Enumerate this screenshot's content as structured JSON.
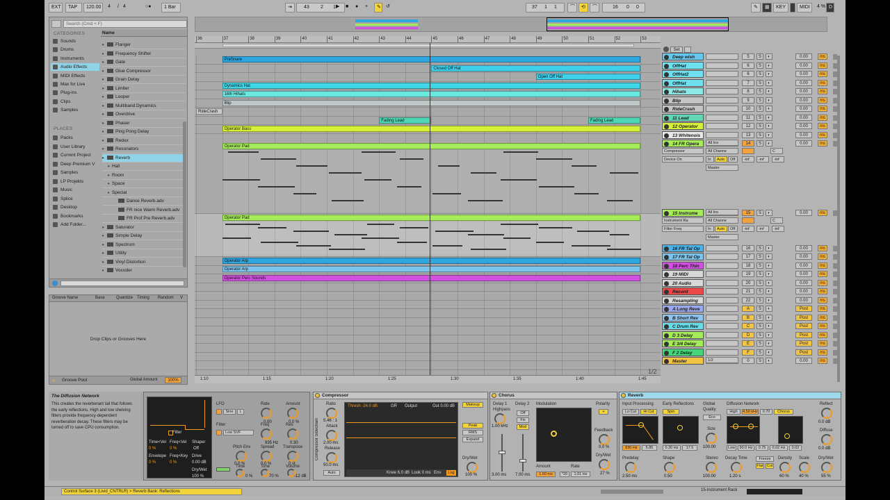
{
  "transport": {
    "ext": "EXT",
    "tap": "TAP",
    "tempo": "120.00",
    "sig_num": "4",
    "sig_den": "4",
    "metro": "○●",
    "quant": "1 Bar",
    "pos_bar": "43",
    "pos_beat": "2",
    "pos_sixteenth": "1",
    "loop_start_bar": "37",
    "loop_start_beat": "1",
    "loop_start_sixteenth": "1",
    "loop_len_bar": "16",
    "loop_len_beat": "0",
    "loop_len_sixteenth": "0",
    "key": "KEY",
    "midi": "MIDI",
    "cpu": "4 %",
    "d_indicator": "D"
  },
  "browser": {
    "search_placeholder": "Search (Cmd + F)",
    "categories_title": "CATEGORIES",
    "categories": [
      "Sounds",
      "Drums",
      "Instruments",
      "Audio Effects",
      "MIDI Effects",
      "Max for Live",
      "Plug-ins",
      "Clips",
      "Samples"
    ],
    "places_title": "PLACES",
    "places": [
      "Packs",
      "User Library",
      "Current Project",
      "Deep Premium V",
      "Samples",
      "LP Projekts",
      "Music",
      "Splice",
      "Desktop",
      "Bookmarks",
      "Add Folder..."
    ],
    "name_header": "Name",
    "files": [
      {
        "name": "Flanger",
        "indent": 0,
        "sel": false,
        "fold": true
      },
      {
        "name": "Frequency Shifter",
        "indent": 0,
        "sel": false,
        "fold": true
      },
      {
        "name": "Gate",
        "indent": 0,
        "sel": false,
        "fold": true
      },
      {
        "name": "Glue Compressor",
        "indent": 0,
        "sel": false,
        "fold": true
      },
      {
        "name": "Grain Delay",
        "indent": 0,
        "sel": false,
        "fold": true
      },
      {
        "name": "Limiter",
        "indent": 0,
        "sel": false,
        "fold": true
      },
      {
        "name": "Looper",
        "indent": 0,
        "sel": false,
        "fold": true
      },
      {
        "name": "Multiband Dynamics",
        "indent": 0,
        "sel": false,
        "fold": true
      },
      {
        "name": "Overdrive",
        "indent": 0,
        "sel": false,
        "fold": true
      },
      {
        "name": "Phaser",
        "indent": 0,
        "sel": false,
        "fold": true
      },
      {
        "name": "Ping Pong Delay",
        "indent": 0,
        "sel": false,
        "fold": true
      },
      {
        "name": "Redux",
        "indent": 0,
        "sel": false,
        "fold": true
      },
      {
        "name": "Resonators",
        "indent": 0,
        "sel": false,
        "fold": true
      },
      {
        "name": "Reverb",
        "indent": 0,
        "sel": true,
        "fold": true
      },
      {
        "name": "Hall",
        "indent": 1,
        "sel": false,
        "fold": false
      },
      {
        "name": "Room",
        "indent": 1,
        "sel": false,
        "fold": false
      },
      {
        "name": "Space",
        "indent": 1,
        "sel": false,
        "fold": false
      },
      {
        "name": "Special",
        "indent": 1,
        "sel": false,
        "fold": false
      },
      {
        "name": "Dance Reverb.adv",
        "indent": 2,
        "sel": false,
        "fold": false
      },
      {
        "name": "FR nice Warm Reverb.adv",
        "indent": 2,
        "sel": false,
        "fold": false
      },
      {
        "name": "FR Prof Pre Reverb.adv",
        "indent": 2,
        "sel": false,
        "fold": false
      },
      {
        "name": "Saturator",
        "indent": 0,
        "sel": false,
        "fold": true
      },
      {
        "name": "Simple Delay",
        "indent": 0,
        "sel": false,
        "fold": true
      },
      {
        "name": "Spectrum",
        "indent": 0,
        "sel": false,
        "fold": true
      },
      {
        "name": "Utility",
        "indent": 0,
        "sel": false,
        "fold": true
      },
      {
        "name": "Vinyl Distortion",
        "indent": 0,
        "sel": false,
        "fold": true
      },
      {
        "name": "Vocoder",
        "indent": 0,
        "sel": false,
        "fold": true
      }
    ]
  },
  "groove": {
    "cols": [
      "Groove Name",
      "Base",
      "Quantize",
      "Timing",
      "Random",
      "V"
    ],
    "drop_text": "Drop Clips or Grooves Here",
    "pool_label": "Groove Pool",
    "global_amount_label": "Global Amount",
    "global_amount": "100%"
  },
  "arrangement": {
    "ruler_marks": [
      "36",
      "37",
      "38",
      "39",
      "40",
      "41",
      "42",
      "43",
      "44",
      "45",
      "46",
      "47",
      "48",
      "49",
      "50",
      "51",
      "52",
      "53"
    ],
    "time_marks": [
      "1:10",
      "1:15",
      "1:20",
      "1:25",
      "1:30",
      "1:35",
      "1:40",
      "1:45"
    ],
    "zoom_label": "1/2",
    "clips": [
      {
        "lane": 0,
        "name": "PreSnare",
        "start": 37,
        "end": 53,
        "color": "#2fa6e0"
      },
      {
        "lane": 1,
        "name": "Closed Off Hat",
        "start": 45,
        "end": 53,
        "color": "#3fd0ec"
      },
      {
        "lane": 2,
        "name": "Open Off Hat",
        "start": 49,
        "end": 53,
        "color": "#3fd0ec"
      },
      {
        "lane": 3,
        "name": "Dynamics Hat",
        "start": 37,
        "end": 53,
        "color": "#3fd6e8"
      },
      {
        "lane": 4,
        "name": "16th Hihats",
        "start": 37,
        "end": 53,
        "color": "#69e8e0"
      },
      {
        "lane": 5,
        "name": "Blip",
        "start": 37,
        "end": 53,
        "color": "#bfc6c6"
      },
      {
        "lane": 6,
        "name": "RideCrash",
        "start": 36,
        "end": 37,
        "color": "#c9c9c9"
      },
      {
        "lane": 7,
        "name": "Fading Lead",
        "start": 43,
        "end": 45,
        "color": "#4fd6b4"
      },
      {
        "lane": 7,
        "name": "Fading Lead",
        "start": 51,
        "end": 53,
        "color": "#4fd6b4"
      },
      {
        "lane": 8,
        "name": "Operator Bass",
        "start": 37,
        "end": 53,
        "color": "#d6f03a"
      },
      {
        "lane": 9,
        "name": "Operator Pad",
        "start": 37,
        "end": 53,
        "color": "#a6ec5a"
      },
      {
        "lane": 10,
        "name": "Operator Pad",
        "start": 37,
        "end": 53,
        "color": "#a6ec5a"
      },
      {
        "lane": 11,
        "name": "Operator Arp",
        "start": 37,
        "end": 53,
        "color": "#2fa6e0"
      },
      {
        "lane": 12,
        "name": "Operator Arp",
        "start": 37,
        "end": 53,
        "color": "#7cc4ec"
      },
      {
        "lane": 13,
        "name": "Operator Perc Sounds",
        "start": 37,
        "end": 53,
        "color": "#d250e0"
      }
    ]
  },
  "tracks": [
    {
      "name": "Deep wish",
      "color": "#66c8ef",
      "num": "5"
    },
    {
      "name": "OffHat",
      "color": "#6ee0ef",
      "num": "6"
    },
    {
      "name": "OffHat2",
      "color": "#6ee0ef",
      "num": "6"
    },
    {
      "name": "OffHat",
      "color": "#6ee0ef",
      "num": "7"
    },
    {
      "name": "Hihats",
      "color": "#8ee8e6",
      "num": "8"
    },
    {
      "name": "Blip",
      "color": "#c4c4c4",
      "num": "9"
    },
    {
      "name": "RideCrash",
      "color": "#c4c4c4",
      "num": "10"
    },
    {
      "name": "11 Lead",
      "color": "#62d8b6",
      "num": "11"
    },
    {
      "name": "12 Operator",
      "color": "#d6f03a",
      "num": "12"
    },
    {
      "name": "13 Whitenois",
      "color": "#e8e8e8",
      "num": "13"
    },
    {
      "name": "14 FR Opera",
      "color": "#a6ec5a",
      "num": "14"
    },
    {
      "name": "15 Instrume",
      "color": "#a6ec5a",
      "num": "15"
    },
    {
      "name": "16 FR Tal Op",
      "color": "#4cb2e6",
      "num": "16"
    },
    {
      "name": "17 FR Tal Op",
      "color": "#7cc4ec",
      "num": "17"
    },
    {
      "name": "18 Perc Thin",
      "color": "#d250e0",
      "num": "18"
    },
    {
      "name": "19 MIDI",
      "color": "#d8d8d8",
      "num": "19"
    },
    {
      "name": "20 Audio",
      "color": "#d8d8d8",
      "num": "20"
    },
    {
      "name": "Record",
      "color": "#ea4848",
      "num": "21"
    },
    {
      "name": "Resampling",
      "color": "#d8d8d8",
      "num": "22"
    },
    {
      "name": "A Long Reve",
      "color": "#9aa8ee",
      "num": "A"
    },
    {
      "name": "B Short Rev",
      "color": "#8fc4ee",
      "num": "B"
    },
    {
      "name": "C Drum Rev",
      "color": "#6cdbe8",
      "num": "C"
    },
    {
      "name": "D 3 Delay",
      "color": "#a6ec5a",
      "num": "D"
    },
    {
      "name": "E 3/4 Delay",
      "color": "#a6ec5a",
      "num": "E"
    },
    {
      "name": "F 2 Delay",
      "color": "#42d87a",
      "num": "F"
    },
    {
      "name": "Master",
      "color": "#f2c444",
      "num": "0"
    }
  ],
  "track_common": {
    "s": "S",
    "vol": "0.00",
    "ms": "ms",
    "post": "Post",
    "inf": "-inf",
    "all_ins": "All Ins",
    "all_chan": "All Channe",
    "in": "In",
    "auto": "Auto",
    "off": "Off",
    "master": "Master",
    "compressor": "Compressor",
    "device_on": "Device On",
    "instrument_rack": "Instrument Ra",
    "filter_freq": "Filter Freq",
    "c": "C",
    "set": "Set",
    "master_io": "1/2"
  },
  "info": {
    "title": "The Diffusion Network",
    "body": "This creates the reverberant tail that follows the early reflections. High and low shelving filters provide frequency-dependent reverberation decay. These filters may be turned off to save CPU consumption."
  },
  "instrument": {
    "lfo": "LFO",
    "rate": "Rate",
    "amount": "Amount",
    "sine": "Sine",
    "l": "L",
    "rate_val": "0.00",
    "amount_val": "0.0 %",
    "filter": "Filter",
    "filter_type": "Low SVF",
    "freq": "Freq",
    "freq_val": "935 Hz",
    "res": "Res",
    "res_val": "0.30",
    "pitch_env": "Pitch Env",
    "pitch_val": "0.0 %",
    "spread": "Spread",
    "spread_val": "0.0 %",
    "transpose": "Transpose",
    "transpose_val": "0 st",
    "time": "Time",
    "time_val": "0 %",
    "tone": "Tone",
    "tone_val": "70 %",
    "volume": "Volume",
    "volume_val": "-12 dB",
    "time_vel": "Time<Vel",
    "freq_vel": "Freq<Vel",
    "shaper": "Shaper",
    "envelope": "Envelope",
    "freq_key": "Freq<Key",
    "drive": "Drive",
    "dry_wet": "Dry/Wet",
    "shaper_val": "Off",
    "drive_val": "0.00 dB",
    "dry_wet_val": "100 %",
    "filter_label": "Filter",
    "zero": "0 %"
  },
  "compressor": {
    "title": "Compressor",
    "sidechain": "Compressor Sidechain",
    "ratio": "Ratio",
    "ratio_val": "5.46 : 1",
    "attack": "Attack",
    "attack_val": "2.00 ms",
    "release": "Release",
    "release_val": "50.0 ms",
    "auto": "Auto",
    "thresh": "Thresh -24.0 dB",
    "gr": "GR",
    "output": "Output",
    "out": "Out 0.00 dB",
    "makeup": "Makeup",
    "peak": "Peak",
    "rms": "RMS",
    "expand": "Expand",
    "knee": "Knee 6.0 dB",
    "look": "Look 0 ms",
    "env": "Env",
    "log": "Log",
    "dry_wet": "Dry/Wet",
    "dry_wet_val": "100 %"
  },
  "chorus": {
    "title": "Chorus",
    "delay1": "Delay 1",
    "delay2": "Delay 2",
    "highpass": "Highpass",
    "hp_val": "1.00 kHz",
    "off": "Off",
    "fix": "Fix",
    "mod": "Mod",
    "d1_val": "3.00 ms",
    "d2_val": "7.00 ms",
    "modulation": "Modulation",
    "amount": "Amount",
    "amount_val": "1.60 ms",
    "rate": "Rate",
    "rate_val": "1.01 Hz",
    "x20": "*20",
    "polarity": "Polarity",
    "plus": "+",
    "feedback": "Feedback",
    "fb_val": "0.0 %",
    "dry_wet": "Dry/Wet",
    "dw_val": "27 %"
  },
  "reverb": {
    "title": "Reverb",
    "input": "Input Processing",
    "lo_cut": "Lo Cut",
    "hi_cut": "Hi Cut",
    "in_freq": "830 Hz",
    "in_width": "5.85",
    "early": "Early Reflections",
    "spin": "Spin",
    "early_freq": "0.30 Hz",
    "early_amt": "17.5",
    "global": "Global",
    "quality": "Quality",
    "eco": "Eco",
    "size": "Size",
    "size_val": "100.00",
    "diffusion": "Diffusion Network",
    "high": "High",
    "high_val": "4.50 kHz",
    "high_amt": "0.70",
    "chorus": "Chorus",
    "low": "Low",
    "low_val": "90.0 Hz",
    "low_amt": "0.75",
    "chorus_val": "0.02 Hz",
    "chorus_amt": "0.02",
    "reflect": "Reflect",
    "reflect_val": "0.0 dB",
    "diffuse": "Diffuse",
    "diffuse_val": "0.0 dB",
    "predelay": "Predelay",
    "predelay_val": "2.50 ms",
    "shape": "Shape",
    "shape_val": "0.50",
    "stereo": "Stereo",
    "stereo_val": "100.00",
    "decay": "Decay Time",
    "decay_val": "1.20 s",
    "freeze": "Freeze",
    "flat": "Flat",
    "cut": "Cut",
    "density": "Density",
    "density_val": "60 %",
    "scale": "Scale",
    "scale_val": "40 %",
    "dry_wet": "Dry/Wet",
    "dry_wet_val": "55 %"
  },
  "status": {
    "message": "Control Surface 3 (Livid_CNTRLR) > Reverb Bank: Reflections",
    "rack": "15-Instrument Rack"
  }
}
